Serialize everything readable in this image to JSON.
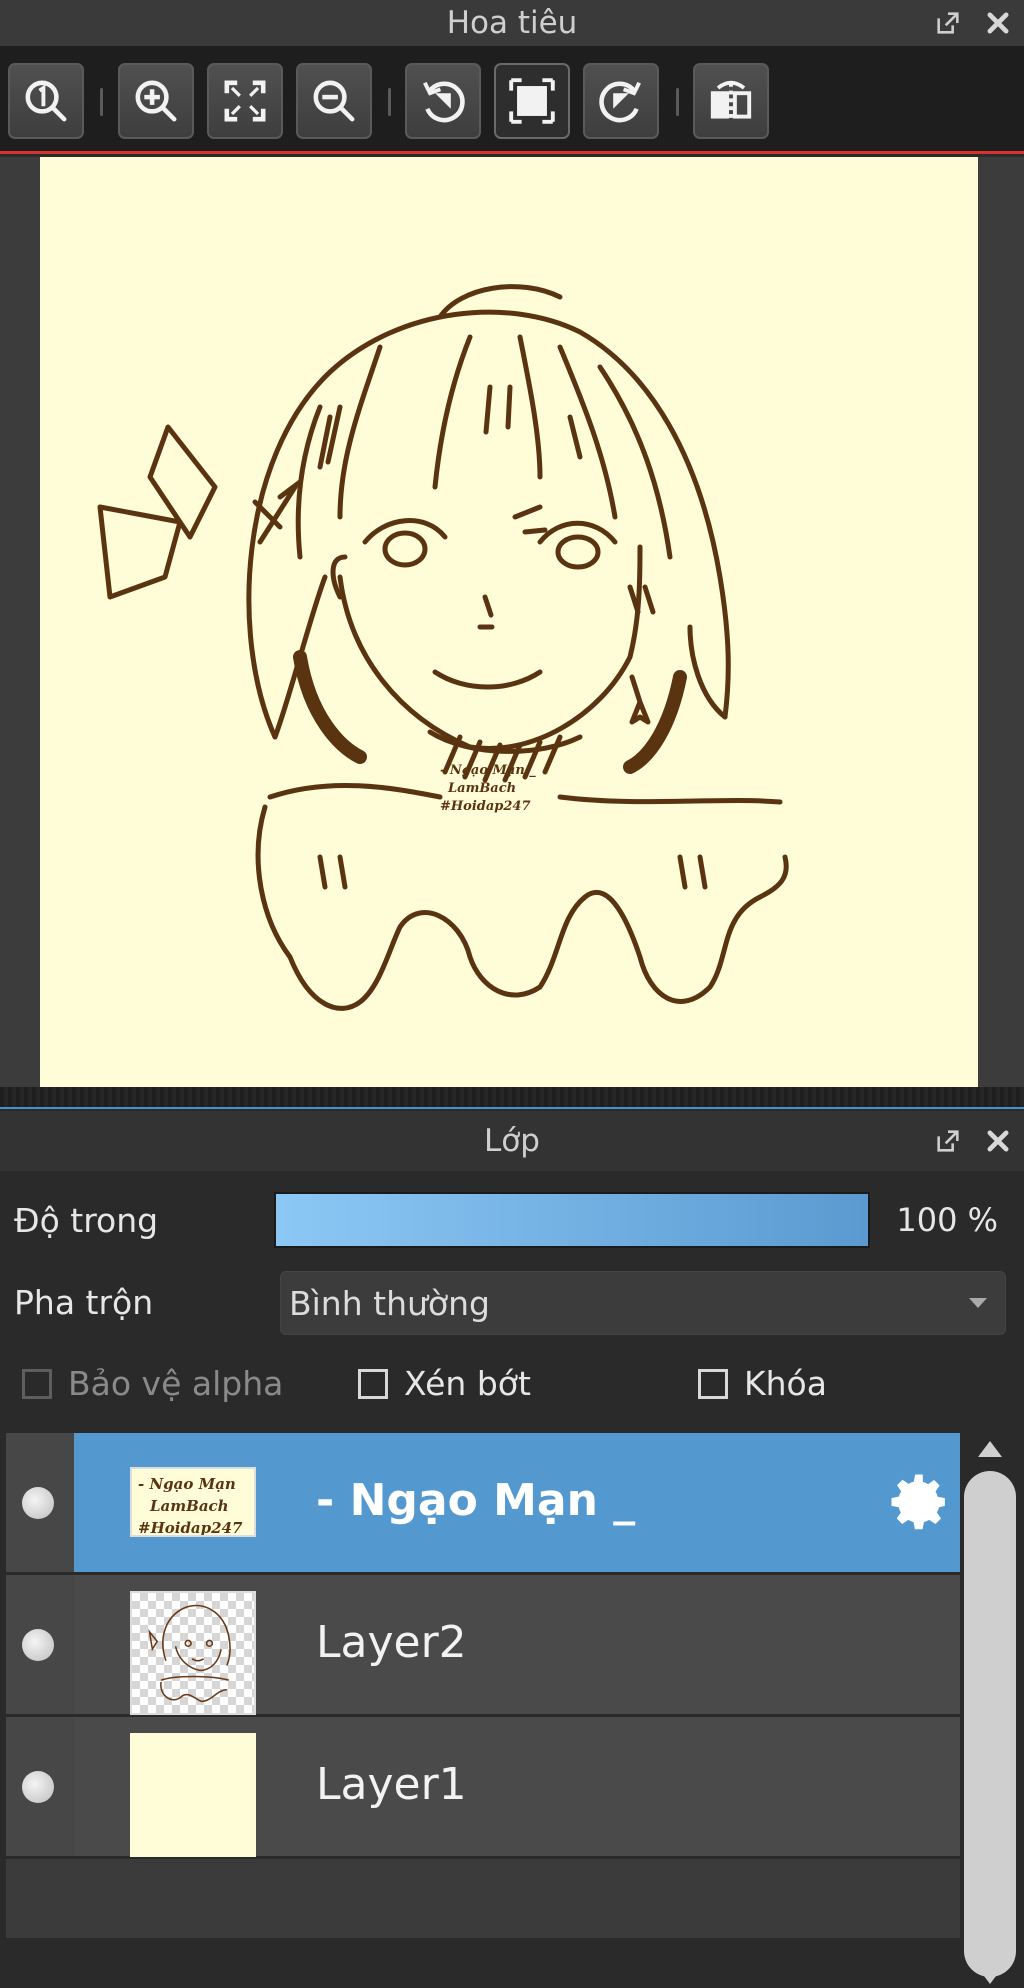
{
  "navigator": {
    "title": "Hoa tiêu",
    "icons": [
      "external-window-icon",
      "close-icon"
    ],
    "toolbar": [
      {
        "name": "zoom-actual-size",
        "icon": "zoom-100-icon"
      },
      {
        "name": "zoom-in",
        "icon": "zoom-in-icon"
      },
      {
        "name": "fit-to-window",
        "icon": "fit-screen-icon"
      },
      {
        "name": "zoom-out",
        "icon": "zoom-out-icon"
      },
      {
        "name": "rotate-left",
        "icon": "rotate-ccw-icon"
      },
      {
        "name": "reset-view",
        "icon": "frame-icon"
      },
      {
        "name": "rotate-right",
        "icon": "rotate-cw-icon"
      },
      {
        "name": "flip-horizontal",
        "icon": "flip-icon"
      }
    ],
    "canvas": {
      "watermark_lines": [
        "- Ngạo Mạn _",
        "LamBach",
        "#Hoidap247"
      ]
    }
  },
  "layers": {
    "title": "Lớp",
    "opacity_label": "Độ trong",
    "opacity_value": "100 %",
    "opacity": 1.0,
    "blend_label": "Pha trộn",
    "blend_value": "Bình thường",
    "protect_alpha": "Bảo vệ alpha",
    "clipping": "Xén bớt",
    "lock": "Khóa",
    "list": [
      {
        "name": "- Ngạo Mạn _",
        "selected": true,
        "thumb_lines": [
          "- Ngạo Mạn",
          "LamBach",
          "#Hoidap247"
        ]
      },
      {
        "name": "Layer2",
        "selected": false
      },
      {
        "name": "Layer1",
        "selected": false
      }
    ]
  },
  "colors": {
    "accent_blue": "#5399cf",
    "paper": "#fffcd8",
    "line_art": "#5a3410",
    "panel_divider": "#d8322f"
  }
}
